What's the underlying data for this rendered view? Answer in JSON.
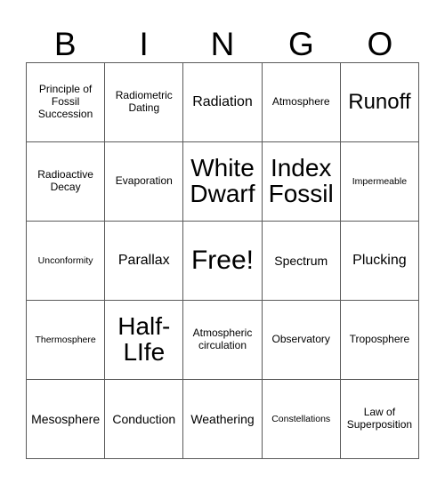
{
  "card": {
    "header_letters": [
      "B",
      "I",
      "N",
      "G",
      "O"
    ],
    "rows": [
      [
        {
          "text": "Principle of Fossil Succession",
          "size": "sz-s"
        },
        {
          "text": "Radiometric Dating",
          "size": "sz-s"
        },
        {
          "text": "Radiation",
          "size": "sz-l"
        },
        {
          "text": "Atmosphere",
          "size": "sz-s"
        },
        {
          "text": "Runoff",
          "size": "sz-xl"
        }
      ],
      [
        {
          "text": "Radioactive Decay",
          "size": "sz-s"
        },
        {
          "text": "Evaporation",
          "size": "sz-s"
        },
        {
          "text": "White Dwarf",
          "size": "sz-xxl"
        },
        {
          "text": "Index Fossil",
          "size": "sz-xxl"
        },
        {
          "text": "Impermeable",
          "size": "sz-xs"
        }
      ],
      [
        {
          "text": "Unconformity",
          "size": "sz-xs"
        },
        {
          "text": "Parallax",
          "size": "sz-l"
        },
        {
          "text": "Free!",
          "size": "sz-free"
        },
        {
          "text": "Spectrum",
          "size": "sz-m"
        },
        {
          "text": "Plucking",
          "size": "sz-l"
        }
      ],
      [
        {
          "text": "Thermosphere",
          "size": "sz-xs"
        },
        {
          "text": "Half-LIfe",
          "size": "sz-xxl"
        },
        {
          "text": "Atmospheric circulation",
          "size": "sz-s"
        },
        {
          "text": "Observatory",
          "size": "sz-s"
        },
        {
          "text": "Troposphere",
          "size": "sz-s"
        }
      ],
      [
        {
          "text": "Mesosphere",
          "size": "sz-m"
        },
        {
          "text": "Conduction",
          "size": "sz-m"
        },
        {
          "text": "Weathering",
          "size": "sz-m"
        },
        {
          "text": "Constellations",
          "size": "sz-xs"
        },
        {
          "text": "Law of Superposition",
          "size": "sz-s"
        }
      ]
    ]
  },
  "colors": {
    "text": "#000000",
    "border": "#5a5a5a",
    "background": "#ffffff"
  }
}
